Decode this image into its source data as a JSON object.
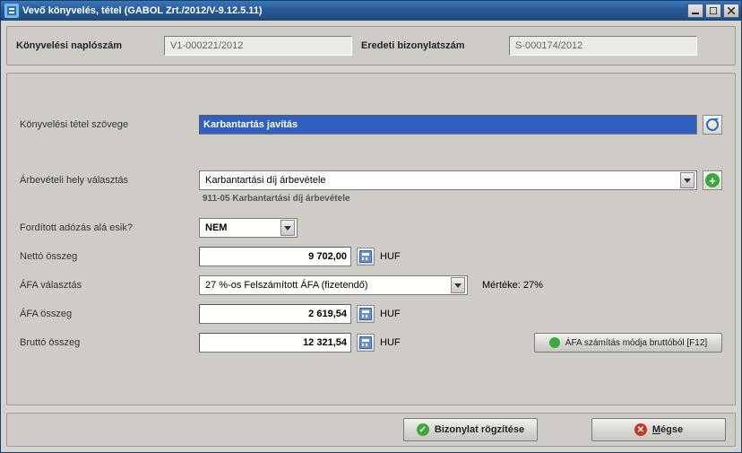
{
  "window": {
    "title": "Vevő könyvelés, tétel (GABOL Zrt./2012/V-9.12.5.11)"
  },
  "header": {
    "journal_label": "Könyvelési naplószám",
    "journal_value": "V1-000221/2012",
    "voucher_label": "Eredeti bizonylatszám",
    "voucher_value": "S-000174/2012"
  },
  "form": {
    "entry_text_label": "Könyvelési tétel szövege",
    "entry_text_value": "Karbantartás javítás",
    "revenue_place_label": "Árbevételi hely választás",
    "revenue_place_value": "Karbantartási díj árbevétele",
    "revenue_place_sub": "911-05 Karbantartási díj árbevétele",
    "reverse_vat_label": "Fordított adózás alá esik?",
    "reverse_vat_value": "NEM",
    "net_label": "Nettó összeg",
    "net_value": "9 702,00",
    "currency": "HUF",
    "vat_select_label": "ÁFA választás",
    "vat_select_value": "27 %-os Felszámított  ÁFA (fizetendő)",
    "vat_rate_label": "Mértéke: 27%",
    "vat_amount_label": "ÁFA összeg",
    "vat_amount_value": "2 619,54",
    "gross_label": "Bruttó összeg",
    "gross_value": "12 321,54",
    "vat_mode_button": "ÁFA számítás módja bruttóból [F12]"
  },
  "footer": {
    "save": "Bizonylat rögzítése",
    "cancel": "Mégse"
  }
}
